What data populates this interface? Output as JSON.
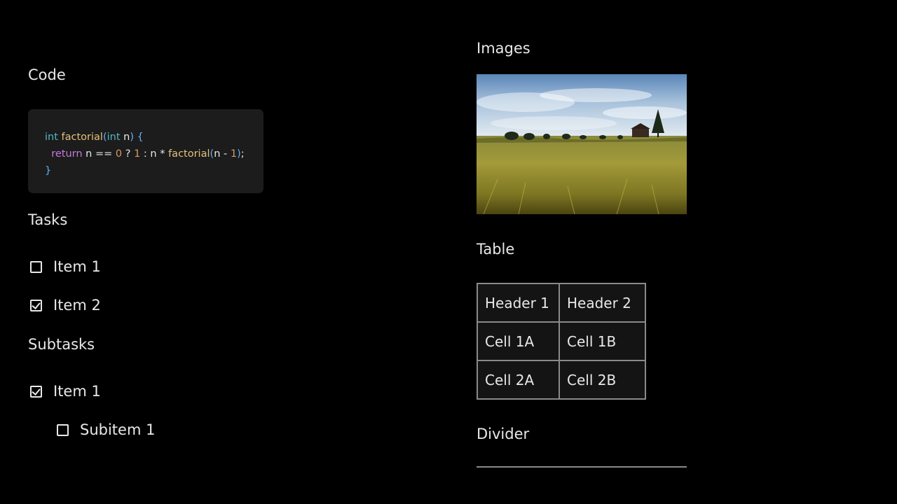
{
  "code_section": {
    "title": "Code",
    "lines": [
      [
        {
          "cls": "tok-type",
          "text": "int "
        },
        {
          "cls": "tok-func",
          "text": "factorial"
        },
        {
          "cls": "tok-punc",
          "text": "("
        },
        {
          "cls": "tok-type",
          "text": "int "
        },
        {
          "cls": "tok-var",
          "text": "n"
        },
        {
          "cls": "tok-punc",
          "text": ") {"
        }
      ],
      [
        {
          "cls": "tok-op",
          "text": "  "
        },
        {
          "cls": "tok-keyword",
          "text": "return "
        },
        {
          "cls": "tok-var",
          "text": "n "
        },
        {
          "cls": "tok-op",
          "text": "== "
        },
        {
          "cls": "tok-num",
          "text": "0 "
        },
        {
          "cls": "tok-op",
          "text": "? "
        },
        {
          "cls": "tok-num",
          "text": "1 "
        },
        {
          "cls": "tok-op",
          "text": ": "
        },
        {
          "cls": "tok-var",
          "text": "n "
        },
        {
          "cls": "tok-op",
          "text": "* "
        },
        {
          "cls": "tok-func",
          "text": "factorial"
        },
        {
          "cls": "tok-punc",
          "text": "("
        },
        {
          "cls": "tok-var",
          "text": "n "
        },
        {
          "cls": "tok-op",
          "text": "- "
        },
        {
          "cls": "tok-num",
          "text": "1"
        },
        {
          "cls": "tok-punc",
          "text": ")"
        },
        {
          "cls": "tok-op",
          "text": ";"
        }
      ],
      [
        {
          "cls": "tok-punc",
          "text": "}"
        }
      ]
    ]
  },
  "tasks_section": {
    "title": "Tasks",
    "items": [
      {
        "label": "Item 1",
        "checked": false
      },
      {
        "label": "Item 2",
        "checked": true
      }
    ]
  },
  "subtasks_section": {
    "title": "Subtasks",
    "item": {
      "label": "Item 1",
      "checked": true
    },
    "subitem": {
      "label": "Subitem 1",
      "checked": false
    }
  },
  "images_section": {
    "title": "Images"
  },
  "table_section": {
    "title": "Table",
    "headers": [
      "Header 1",
      "Header 2"
    ],
    "rows": [
      [
        "Cell 1A",
        "Cell 1B"
      ],
      [
        "Cell 2A",
        "Cell 2B"
      ]
    ]
  },
  "divider_section": {
    "title": "Divider"
  }
}
